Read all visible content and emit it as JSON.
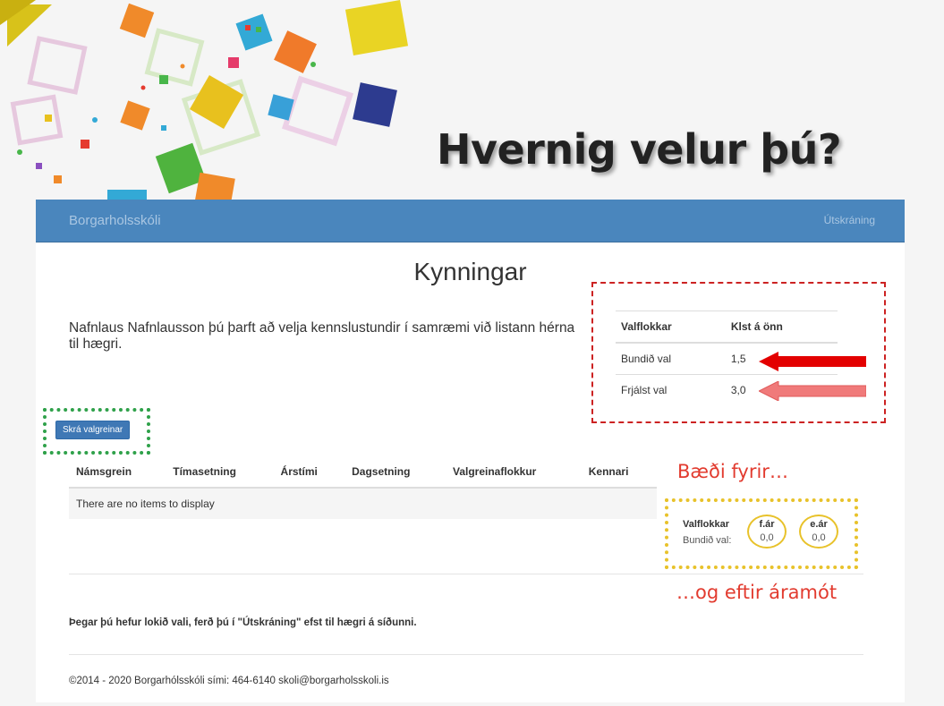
{
  "slide": {
    "title": "Hvernig velur þú?"
  },
  "navbar": {
    "brand": "Borgarholsskóli",
    "logout": "Útskráning"
  },
  "page": {
    "title": "Kynningar",
    "intro": "Nafnlaus Nafnlausson þú þarft að velja kennslustundir í samræmi við listann hérna til hægri.",
    "register_button": "Skrá valgreinar"
  },
  "category_table": {
    "headers": [
      "Valflokkar",
      "Klst á önn"
    ],
    "rows": [
      {
        "name": "Bundið val",
        "hours": "1,5"
      },
      {
        "name": "Frjálst val",
        "hours": "3,0"
      }
    ]
  },
  "courses_table": {
    "headers": [
      "Námsgrein",
      "Tímasetning",
      "Árstími",
      "Dagsetning",
      "Valgreinaflokkur",
      "Kennari"
    ],
    "empty_message": "There are no items to display"
  },
  "annotations": {
    "before": "Bæði fyrir…",
    "after": "…og eftir áramót"
  },
  "summary": {
    "header": "Valflokkar",
    "row_label": "Bundið val:",
    "columns": [
      {
        "label": "f.ár",
        "value": "0,0"
      },
      {
        "label": "e.ár",
        "value": "0,0"
      }
    ]
  },
  "note": "Þegar þú hefur lokið vali, ferð þú í \"Útskráning\" efst til hægri á síðunni.",
  "footer": "©2014 - 2020 Borgarhólsskóli sími: 464-6140 skoli@borgarholsskoli.is",
  "colors": {
    "navbar": "#4a86bd",
    "button": "#3f78b5",
    "annotation_red": "#e23b2f",
    "green_outline": "#2fa14a",
    "yellow_outline": "#e8c22a",
    "arrow_red": "#e30000",
    "arrow_pink": "#f07a7a"
  }
}
